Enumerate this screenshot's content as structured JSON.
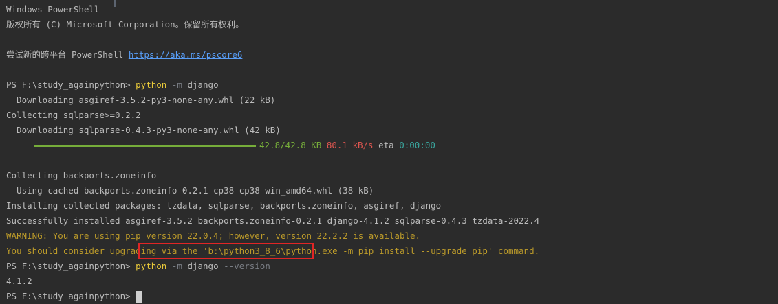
{
  "terminal": {
    "header_title": "Windows PowerShell",
    "copyright": "版权所有 (C) Microsoft Corporation。保留所有权利。",
    "try_new_prefix": "尝试新的跨平台 PowerShell ",
    "try_new_link": "https://aka.ms/pscore6",
    "prompt": "PS F:\\study_againpython> ",
    "cmd1": {
      "exe": "python",
      "flag": "-m",
      "arg": "django"
    },
    "line_download_asgiref": "  Downloading asgiref-3.5.2-py3-none-any.whl (22 kB)",
    "line_collecting_sqlparse": "Collecting sqlparse>=0.2.2",
    "line_download_sqlparse": "  Downloading sqlparse-0.4.3-py3-none-any.whl (42 kB)",
    "progress": {
      "fraction": 1.0,
      "size": "42.8/42.8 KB",
      "speed": "80.1 kB/s",
      "eta_label": "eta",
      "eta": "0:00:00"
    },
    "line_collecting_backports": "Collecting backports.zoneinfo",
    "line_using_cached": "  Using cached backports.zoneinfo-0.2.1-cp38-cp38-win_amd64.whl (38 kB)",
    "line_installing": "Installing collected packages: tzdata, sqlparse, backports.zoneinfo, asgiref, django",
    "line_success": "Successfully installed asgiref-3.5.2 backports.zoneinfo-0.2.1 django-4.1.2 sqlparse-0.4.3 tzdata-2022.4",
    "line_warning": "WARNING: You are using pip version 22.0.4; however, version 22.2.2 is available.",
    "line_upgrade": "You should consider upgrading via the 'b:\\python3_8_6\\python.exe -m pip install --upgrade pip' command.",
    "cmd2": {
      "exe": "python",
      "flag": "-m",
      "arg": "django",
      "opt": "--version"
    },
    "version_output": "4.1.2"
  },
  "colors": {
    "background": "#2b2b2b",
    "text": "#bbbbbb",
    "command": "#e8c93a",
    "flag": "#7a7e85",
    "link": "#589df6",
    "warning": "#bb9a2a",
    "progress_green": "#76ad3a",
    "progress_red": "#e05650",
    "progress_cyan": "#3aa8a0",
    "highlight_border": "#e02525"
  }
}
